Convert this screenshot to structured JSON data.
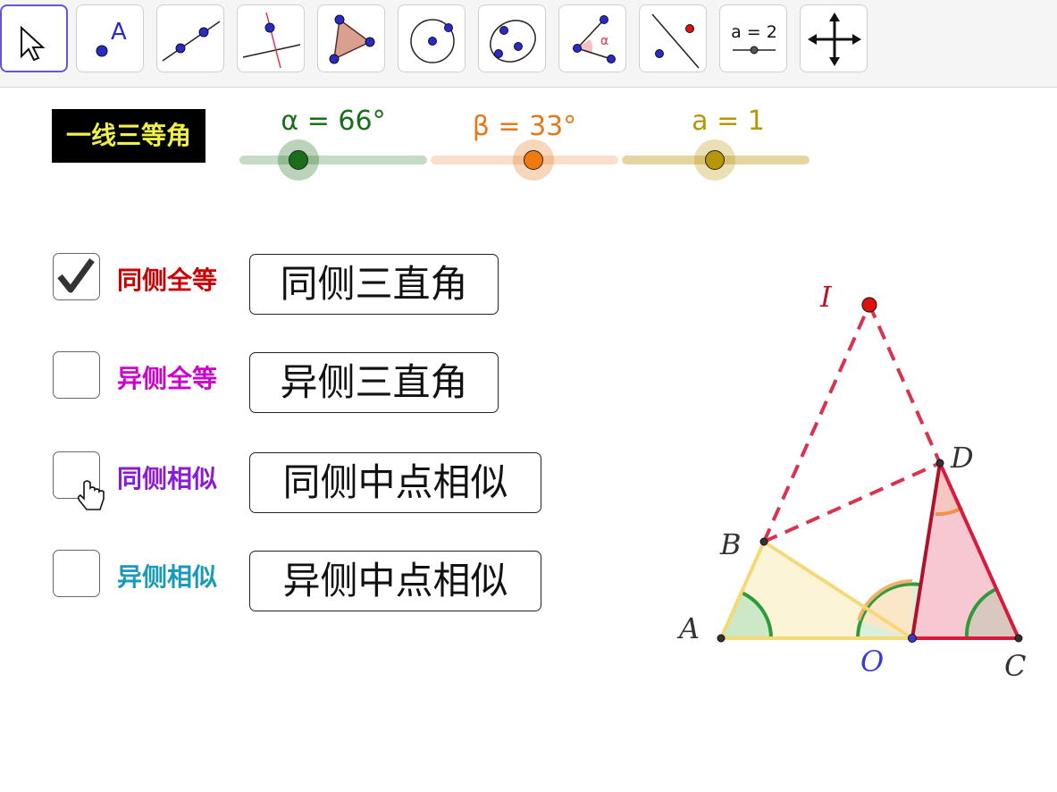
{
  "toolbar": {
    "tools": [
      {
        "name": "move-tool",
        "icon": "cursor-arrow-icon",
        "active": true
      },
      {
        "name": "point-tool",
        "icon": "point-A-icon",
        "text": "A"
      },
      {
        "name": "line-tool",
        "icon": "line-through-points-icon"
      },
      {
        "name": "perpendicular-tool",
        "icon": "perpendicular-line-icon"
      },
      {
        "name": "polygon-tool",
        "icon": "triangle-polygon-icon"
      },
      {
        "name": "circle-tool",
        "icon": "circle-center-point-icon"
      },
      {
        "name": "ellipse-tool",
        "icon": "ellipse-icon"
      },
      {
        "name": "angle-tool",
        "icon": "angle-alpha-icon",
        "text": "α"
      },
      {
        "name": "reflect-tool",
        "icon": "reflect-point-icon"
      },
      {
        "name": "slider-tool",
        "icon": "slider-a2-icon",
        "text": "a = 2"
      },
      {
        "name": "move-view-tool",
        "icon": "move-graphics-view-icon"
      }
    ]
  },
  "title": "一线三等角",
  "sliders": [
    {
      "label": "α = 66°",
      "color": "#1a6e1a",
      "value": 66,
      "min": 0,
      "max": 180
    },
    {
      "label": "β = 33°",
      "color": "#e07a1b",
      "value": 33,
      "min": 0,
      "max": 90
    },
    {
      "label": "a = 1",
      "color": "#b8960a",
      "value": 1,
      "min": -5,
      "max": 5
    }
  ],
  "options": [
    {
      "checked": true,
      "label": "同侧全等",
      "label_color": "#cc0000",
      "button": "同侧三直角"
    },
    {
      "checked": false,
      "label": "异侧全等",
      "label_color": "#cc00cc",
      "button": "异侧三直角"
    },
    {
      "checked": false,
      "label": "同侧相似",
      "label_color": "#8a1ad6",
      "button": "同侧中点相似"
    },
    {
      "checked": false,
      "label": "异侧相似",
      "label_color": "#1a99b8",
      "button": "异侧中点相似"
    }
  ],
  "figure": {
    "points": {
      "A": "A",
      "B": "B",
      "C": "C",
      "D": "D",
      "O": "O",
      "I": "I"
    },
    "colors": {
      "triangle_ABO": "#f5d878",
      "triangle_ODC": "#d81b3c",
      "angle_arc": "#2e9a3a",
      "dashed": "#d8334f",
      "point_I": "#e01010"
    }
  }
}
